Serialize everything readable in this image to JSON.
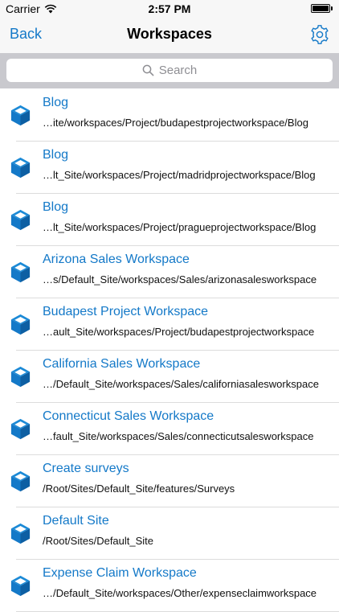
{
  "status_bar": {
    "carrier": "Carrier",
    "time": "2:57 PM",
    "battery_level": 1.0
  },
  "nav": {
    "back_label": "Back",
    "title": "Workspaces"
  },
  "search": {
    "placeholder": "Search"
  },
  "colors": {
    "accent": "#1479c8",
    "bar_background": "#f7f7f7",
    "search_background": "#c9c9ce"
  },
  "rows": [
    {
      "title": "Blog",
      "path": "…ite/workspaces/Project/budapestprojectworkspace/Blog",
      "icon": "cube-icon"
    },
    {
      "title": "Blog",
      "path": "…lt_Site/workspaces/Project/madridprojectworkspace/Blog",
      "icon": "cube-icon"
    },
    {
      "title": "Blog",
      "path": "…lt_Site/workspaces/Project/pragueprojectworkspace/Blog",
      "icon": "cube-icon"
    },
    {
      "title": "Arizona Sales Workspace",
      "path": "…s/Default_Site/workspaces/Sales/arizonasalesworkspace",
      "icon": "cube-icon"
    },
    {
      "title": "Budapest Project Workspace",
      "path": "…ault_Site/workspaces/Project/budapestprojectworkspace",
      "icon": "cube-icon"
    },
    {
      "title": "California Sales Workspace",
      "path": "…/Default_Site/workspaces/Sales/californiasalesworkspace",
      "icon": "cube-icon"
    },
    {
      "title": "Connecticut Sales Workspace",
      "path": "…fault_Site/workspaces/Sales/connecticutsalesworkspace",
      "icon": "cube-icon"
    },
    {
      "title": "Create surveys",
      "path": "/Root/Sites/Default_Site/features/Surveys",
      "icon": "cube-icon"
    },
    {
      "title": "Default Site",
      "path": "/Root/Sites/Default_Site",
      "icon": "cube-icon"
    },
    {
      "title": "Expense Claim Workspace",
      "path": "…/Default_Site/workspaces/Other/expenseclaimworkspace",
      "icon": "cube-icon"
    }
  ]
}
